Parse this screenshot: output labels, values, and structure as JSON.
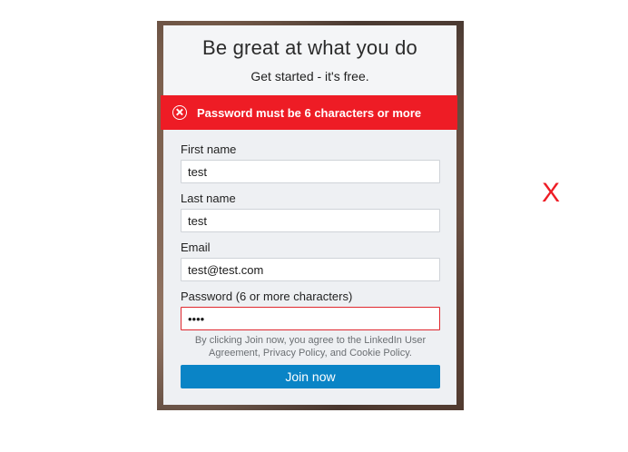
{
  "signup": {
    "title": "Be great at what you do",
    "subtitle": "Get started - it's free.",
    "error": "Password must be 6 characters or more",
    "fields": {
      "first_name": {
        "label": "First name",
        "value": "test"
      },
      "last_name": {
        "label": "Last name",
        "value": "test"
      },
      "email": {
        "label": "Email",
        "value": "test@test.com"
      },
      "password": {
        "label": "Password (6 or more characters)",
        "value": "test"
      }
    },
    "legal_line1": "By clicking Join now, you agree to the LinkedIn User",
    "legal_line2": "Agreement, Privacy Policy, and Cookie Policy.",
    "join_label": "Join now"
  },
  "verdict_mark": "X",
  "colors": {
    "error_red": "#ee1c25",
    "join_blue": "#0a84c6",
    "card_bg": "#eef0f3"
  }
}
